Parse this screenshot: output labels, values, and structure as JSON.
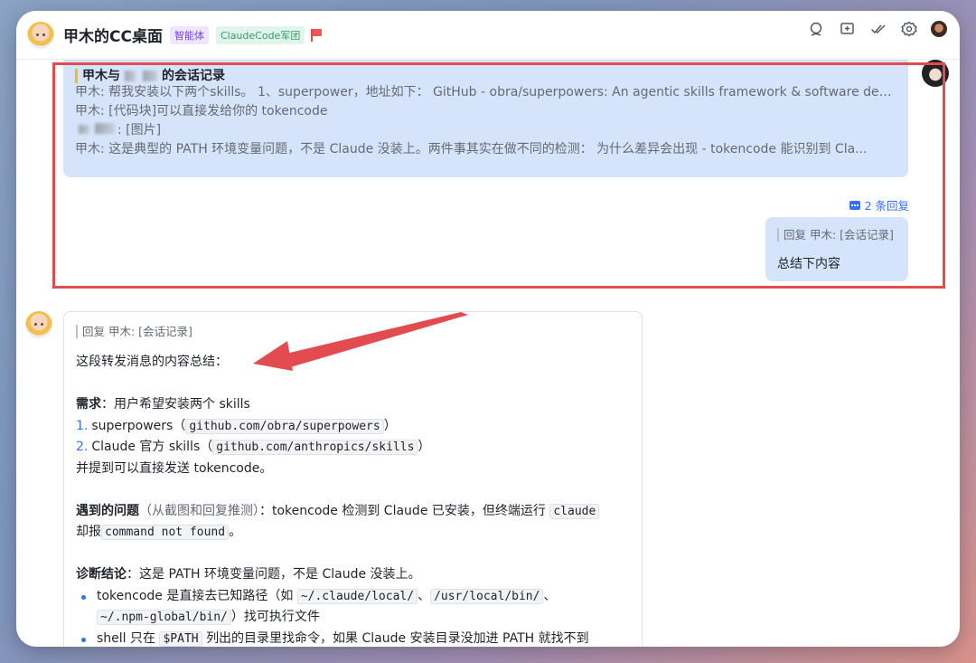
{
  "header": {
    "title": "甲木的CC桌面",
    "tags": [
      "智能体",
      "ClaudeCode军团"
    ]
  },
  "forwarded": {
    "title_prefix": "甲木与",
    "title_suffix": "的会话记录",
    "lines": [
      "甲木: 帮我安装以下两个skills。 1、superpower，地址如下： GitHub - obra/superpowers: An agentic skills framework & software dev...",
      "甲木: [代码块]可以直接发给你的 tokencode",
      ": [图片]",
      "甲木: 这是典型的 PATH 环境变量问题，不是 Claude 没装上。两件事其实在做不同的检测： 为什么差异会出现 - tokencode 能识别到 Cla..."
    ],
    "reply_count": "2 条回复"
  },
  "me_message": {
    "quote": "回复 甲木: [会话记录]",
    "text": "总结下内容"
  },
  "bot_message": {
    "quote": "回复 甲木: [会话记录]",
    "intro": "这段转发消息的内容总结：",
    "need_label": "需求",
    "need_text": "：用户希望安装两个 skills",
    "item1_num": "1.",
    "item1_text": "superpowers（",
    "item1_code": "github.com/obra/superpowers",
    "item1_end": "）",
    "item2_num": "2.",
    "item2_text": "Claude 官方 skills（",
    "item2_code": "github.com/anthropics/skills",
    "item2_end": "）",
    "also": "并提到可以直接发送 tokencode。",
    "issue_label": "遇到的问题",
    "issue_paren": "（从截图和回复推测）",
    "issue_text": "：tokencode 检测到 Claude 已安装，但终端运行",
    "issue_code1": "claude",
    "issue_text2": "却报",
    "issue_code2": "command not found",
    "issue_end": "。",
    "diag_label": "诊断结论",
    "diag_text": "：这是 PATH 环境变量问题，不是 Claude 没装上。",
    "b1_text": "tokencode 是直接去已知路径（如",
    "b1_code1": "~/.claude/local/",
    "b1_sep1": "、",
    "b1_code2": "/usr/local/bin/",
    "b1_sep2": "、",
    "b1_code3": "~/.npm-global/bin/",
    "b1_end": "）找可执行文件",
    "b2_text": "shell 只在",
    "b2_code": "$PATH",
    "b2_end": "列出的目录里找命令，如果 Claude 安装目录没加进 PATH 就找不到"
  },
  "colors": {
    "accent": "#3370ff",
    "bubble": "#d6e4fb",
    "annotation": "#e24b4f"
  }
}
